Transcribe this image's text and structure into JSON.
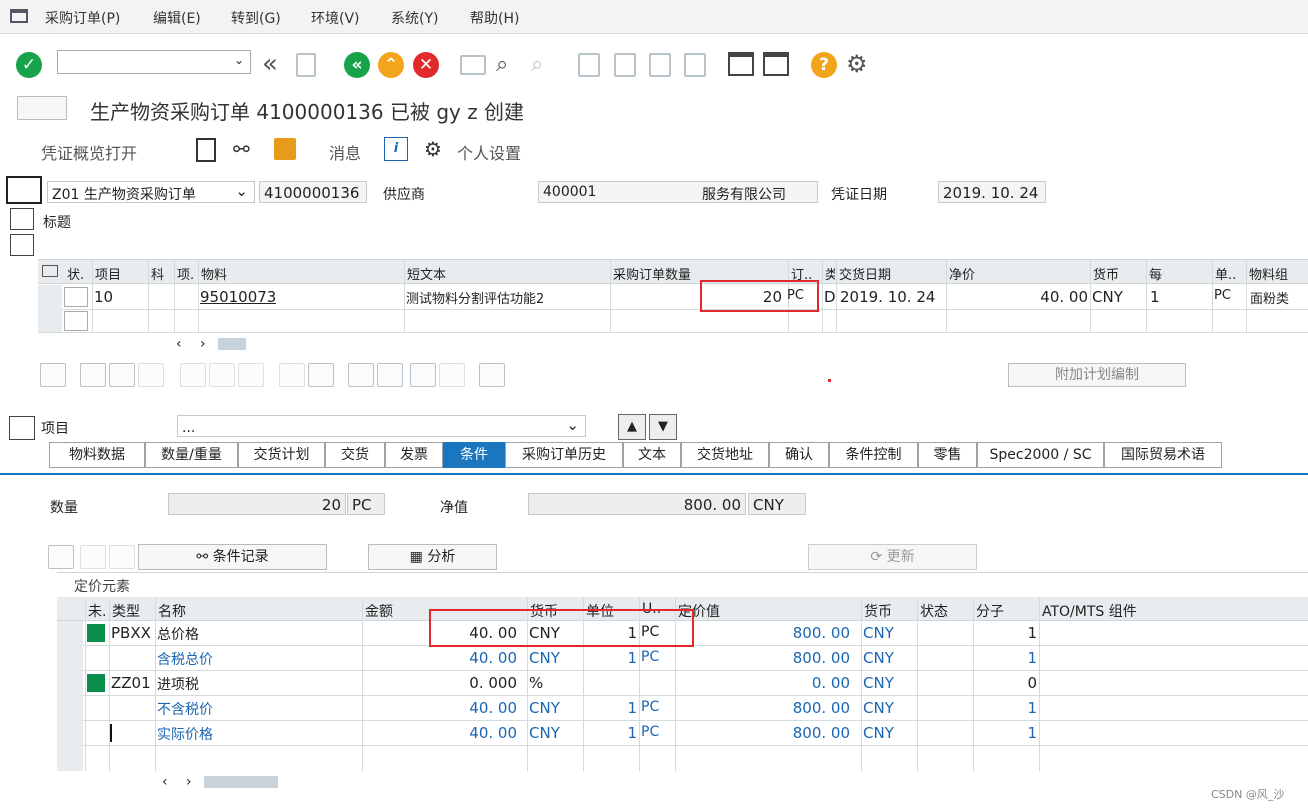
{
  "menu": [
    "采购订单(P)",
    "编辑(E)",
    "转到(G)",
    "环境(V)",
    "系统(Y)",
    "帮助(H)"
  ],
  "page_title": "生产物资采购订单 4100000136 已被 gy z 创建",
  "appbar": {
    "doc_overview": "凭证概览打开",
    "messages": "消息",
    "personal_settings": "个人设置"
  },
  "header": {
    "order_type": "Z01 生产物资采购订单",
    "order_number": "4100000136",
    "vendor_label": "供应商",
    "vendor_value": "400001",
    "vendor_name": "服务有限公司",
    "doc_date_label": "凭证日期",
    "doc_date_value": "2019. 10. 24",
    "header_label": "标题"
  },
  "items_table": {
    "columns": [
      "状.",
      "项目",
      "科",
      "项.",
      "物料",
      "短文本",
      "采购订单数量",
      "订..",
      "类",
      "交货日期",
      "净价",
      "货币",
      "每",
      "单..",
      "物料组"
    ],
    "rows": [
      {
        "item": "10",
        "material": "95010073",
        "short_text": "测试物料分割评估功能2",
        "qty": "20",
        "unit": "PC",
        "d": "D",
        "date": "2019. 10. 24",
        "net_price": "40. 00",
        "currency": "CNY",
        "per": "1",
        "oun": "PC",
        "mat_group": "面粉类"
      }
    ]
  },
  "extra_plan_button": "附加计划编制",
  "item_section": {
    "label": "项目",
    "item_select": "..."
  },
  "tabs": [
    "物料数据",
    "数量/重量",
    "交货计划",
    "交货",
    "发票",
    "条件",
    "采购订单历史",
    "文本",
    "交货地址",
    "确认",
    "条件控制",
    "零售",
    "Spec2000 / SC",
    "国际贸易术语"
  ],
  "active_tab": "条件",
  "conditions": {
    "qty_label": "数量",
    "qty_value": "20",
    "qty_unit": "PC",
    "net_label": "净值",
    "net_value": "800. 00",
    "net_currency": "CNY",
    "cond_record_btn": "条件记录",
    "analysis_btn": "分析",
    "update_btn": "更新",
    "pricing_label": "定价元素",
    "columns": [
      "未.",
      "类型",
      "名称",
      "金额",
      "货币",
      "单位",
      "U..",
      "定价值",
      "货币",
      "状态",
      "分子",
      "ATO/MTS 组件"
    ],
    "rows": [
      {
        "type": "PBXX",
        "name": "总价格",
        "amount": "40. 00",
        "cur": "CNY",
        "unit": "1",
        "uom": "PC",
        "value": "800. 00",
        "cur2": "CNY",
        "num": "1",
        "blue": false,
        "green": true
      },
      {
        "type": "",
        "name": "含税总价",
        "amount": "40. 00",
        "cur": "CNY",
        "unit": "1",
        "uom": "PC",
        "value": "800. 00",
        "cur2": "CNY",
        "num": "1",
        "blue": true,
        "green": false
      },
      {
        "type": "ZZ01",
        "name": "进项税",
        "amount": "0. 000",
        "cur": "%",
        "unit": "",
        "uom": "",
        "value": "0. 00",
        "cur2": "CNY",
        "num": "0",
        "blue": false,
        "green": true
      },
      {
        "type": "",
        "name": "不含税价",
        "amount": "40. 00",
        "cur": "CNY",
        "unit": "1",
        "uom": "PC",
        "value": "800. 00",
        "cur2": "CNY",
        "num": "1",
        "blue": true,
        "green": false
      },
      {
        "type": "",
        "name": "实际价格",
        "amount": "40. 00",
        "cur": "CNY",
        "unit": "1",
        "uom": "PC",
        "value": "800. 00",
        "cur2": "CNY",
        "num": "1",
        "blue": true,
        "green": false
      }
    ]
  },
  "watermark": "CSDN @风_沙"
}
